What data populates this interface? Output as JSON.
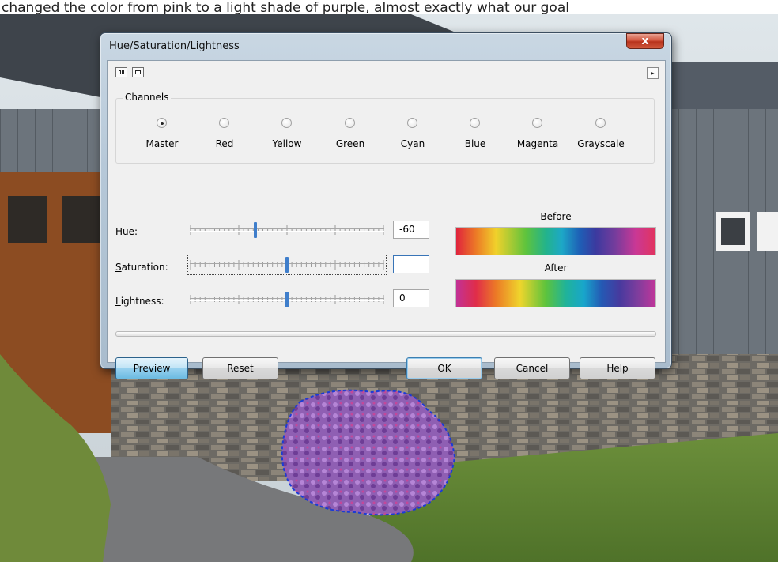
{
  "caption": "changed the color from pink to a light shade of purple, almost exactly what our goal",
  "window": {
    "title": "Hue/Saturation/Lightness",
    "close_glyph": "x"
  },
  "toolbar": {
    "icons": [
      "split-view-icon",
      "single-view-icon"
    ],
    "more_glyph": "▸"
  },
  "channels": {
    "group_label": "Channels",
    "options": [
      {
        "label": "Master",
        "checked": true
      },
      {
        "label": "Red",
        "checked": false
      },
      {
        "label": "Yellow",
        "checked": false
      },
      {
        "label": "Green",
        "checked": false
      },
      {
        "label": "Cyan",
        "checked": false
      },
      {
        "label": "Blue",
        "checked": false
      },
      {
        "label": "Magenta",
        "checked": false
      },
      {
        "label": "Grayscale",
        "checked": false
      }
    ]
  },
  "adjustments": {
    "hue": {
      "label_prefix": "H",
      "label_rest": "ue:",
      "value": "-60",
      "slider_value": -60,
      "min": -180,
      "max": 180
    },
    "saturation": {
      "label_prefix": "S",
      "label_rest": "aturation:",
      "value": "",
      "slider_value": 0,
      "min": -100,
      "max": 100
    },
    "lightness": {
      "label_prefix": "L",
      "label_rest": "ightness:",
      "value": "0",
      "slider_value": 0,
      "min": -100,
      "max": 100
    }
  },
  "preview": {
    "before_label": "Before",
    "after_label": "After"
  },
  "buttons": {
    "preview": "Preview",
    "reset": "Reset",
    "ok": "OK",
    "cancel": "Cancel",
    "help": "Help"
  }
}
